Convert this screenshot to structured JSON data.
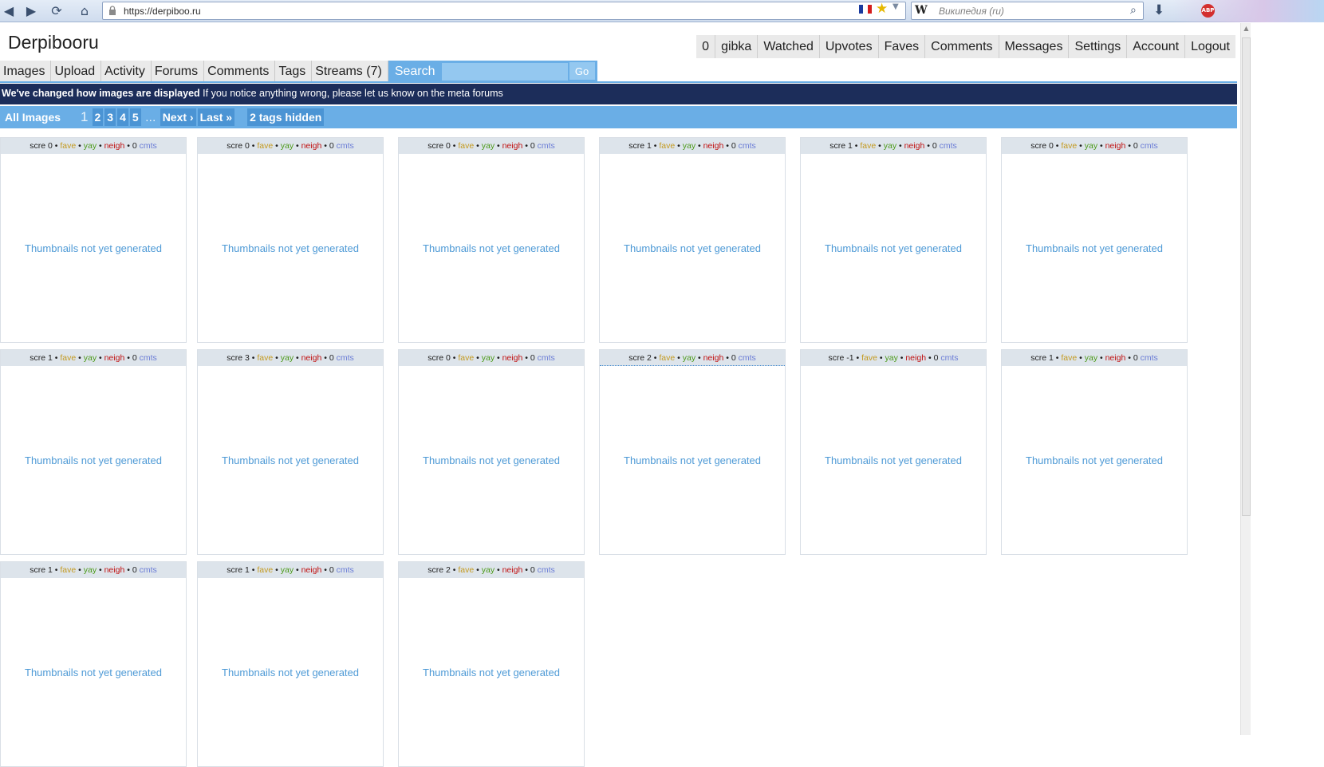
{
  "browser": {
    "url": "https://derpiboo.ru",
    "search_engine_glyph": "W",
    "search_placeholder": "Википедия (ru)",
    "extension_badge": "ABP"
  },
  "site": {
    "logo": "Derpibooru",
    "user_menu": [
      "0",
      "gibka",
      "Watched",
      "Upvotes",
      "Faves",
      "Comments",
      "Messages",
      "Settings",
      "Account",
      "Logout"
    ],
    "main_nav": [
      "Images",
      "Upload",
      "Activity",
      "Forums",
      "Comments",
      "Tags",
      "Streams (7)"
    ],
    "search_label": "Search",
    "search_value": "",
    "go_label": "Go"
  },
  "notice": {
    "bold": "We've changed how images are displayed",
    "text": " If you notice anything wrong, please let us know on the meta forums"
  },
  "paging": {
    "all_images": "All Images",
    "current": "1",
    "pages": [
      "2",
      "3",
      "4",
      "5"
    ],
    "ellipsis": "…",
    "next": "Next ›",
    "last": "Last »",
    "hidden": "2 tags hidden"
  },
  "labels": {
    "fave": "fave",
    "yay": "yay",
    "neigh": "neigh",
    "cmts": "cmts",
    "sep": " • ",
    "placeholder": "Thumbnails not yet generated"
  },
  "images": [
    {
      "score": "scre 0",
      "comments": "0"
    },
    {
      "score": "scre 0",
      "comments": "0"
    },
    {
      "score": "scre 0",
      "comments": "0"
    },
    {
      "score": "scre 1",
      "comments": "0"
    },
    {
      "score": "scre 1",
      "comments": "0"
    },
    {
      "score": "scre 0",
      "comments": "0"
    },
    {
      "score": "scre 1",
      "comments": "0"
    },
    {
      "score": "scre 3",
      "comments": "0"
    },
    {
      "score": "scre 0",
      "comments": "0"
    },
    {
      "score": "scre 2",
      "comments": "0"
    },
    {
      "score": "scre -1",
      "comments": "0"
    },
    {
      "score": "scre 1",
      "comments": "0"
    },
    {
      "score": "scre 1",
      "comments": "0"
    },
    {
      "score": "scre 1",
      "comments": "0"
    },
    {
      "score": "scre 2",
      "comments": "0"
    }
  ]
}
